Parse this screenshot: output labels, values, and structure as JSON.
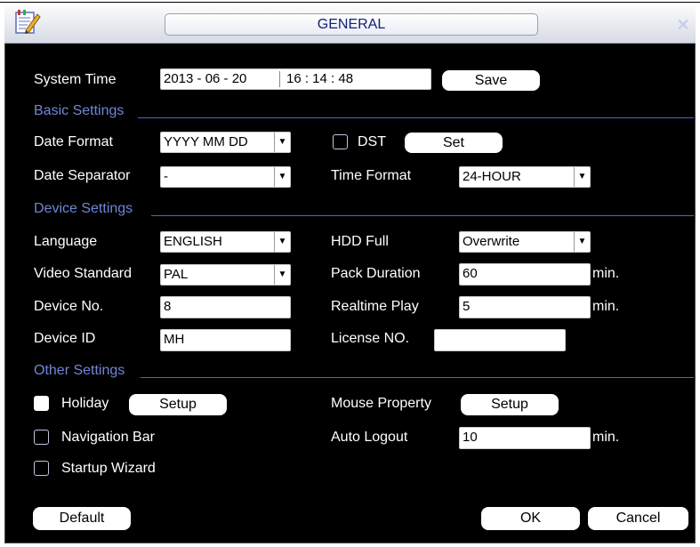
{
  "window": {
    "title": "GENERAL"
  },
  "system_time": {
    "label": "System Time",
    "date": "2013  - 06 - 20",
    "time": "16 : 14 : 48",
    "save_label": "Save"
  },
  "basic": {
    "header": "Basic Settings",
    "date_format_label": "Date Format",
    "date_format_value": "YYYY MM DD",
    "dst_label": "DST",
    "dst_checked": false,
    "set_label": "Set",
    "date_sep_label": "Date Separator",
    "date_sep_value": "-",
    "time_format_label": "Time Format",
    "time_format_value": "24-HOUR"
  },
  "device": {
    "header": "Device Settings",
    "language_label": "Language",
    "language_value": "ENGLISH",
    "hdd_full_label": "HDD Full",
    "hdd_full_value": "Overwrite",
    "video_std_label": "Video Standard",
    "video_std_value": "PAL",
    "pack_duration_label": "Pack Duration",
    "pack_duration_value": "60",
    "device_no_label": "Device No.",
    "device_no_value": "8",
    "realtime_play_label": "Realtime Play",
    "realtime_play_value": "5",
    "device_id_label": "Device ID",
    "device_id_value": "MH",
    "license_label": "License NO.",
    "license_value": "",
    "unit_min": "min."
  },
  "other": {
    "header": "Other Settings",
    "holiday_label": "Holiday",
    "holiday_checked": true,
    "setup_label": "Setup",
    "mouse_label": "Mouse Property",
    "nav_bar_label": "Navigation Bar",
    "nav_bar_checked": false,
    "auto_logout_label": "Auto Logout",
    "auto_logout_value": "10",
    "startup_wizard_label": "Startup Wizard",
    "startup_wizard_checked": false
  },
  "footer": {
    "default_label": "Default",
    "ok_label": "OK",
    "cancel_label": "Cancel"
  },
  "colors": {
    "dialog_bg": "#000000",
    "section_text": "#6f86d6",
    "separator": "#4d66c8",
    "title_text": "#10207a"
  },
  "icons": {
    "title_icon": "settings-notepad-icon",
    "close_icon": "close-x-icon",
    "dropdown_icon": "chevron-down-icon"
  }
}
